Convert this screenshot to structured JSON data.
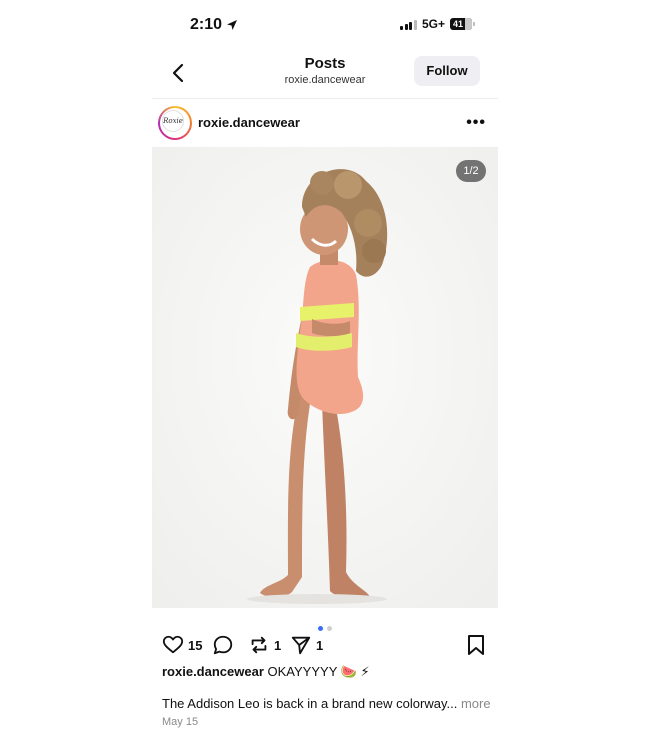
{
  "status_bar": {
    "time": "2:10",
    "network": "5G+",
    "battery": "41"
  },
  "header": {
    "title": "Posts",
    "subtitle": "roxie.dancewear",
    "follow_label": "Follow"
  },
  "post": {
    "avatar_text": "Roxie",
    "username": "roxie.dancewear",
    "image_counter": "1/2",
    "likes": "15",
    "reposts": "1",
    "shares": "1",
    "caption_user": "roxie.dancewear",
    "caption_text": "OKAYYYYY 🍉 ⚡",
    "description": "The Addison Leo is back in a brand new colorway...",
    "more_label": "more",
    "date": "May 15"
  },
  "colors": {
    "active_dot": "#3b6cf6",
    "inactive_dot": "#cfcfcf",
    "follow_bg": "#efeff3",
    "muted": "#8a8a8a"
  }
}
